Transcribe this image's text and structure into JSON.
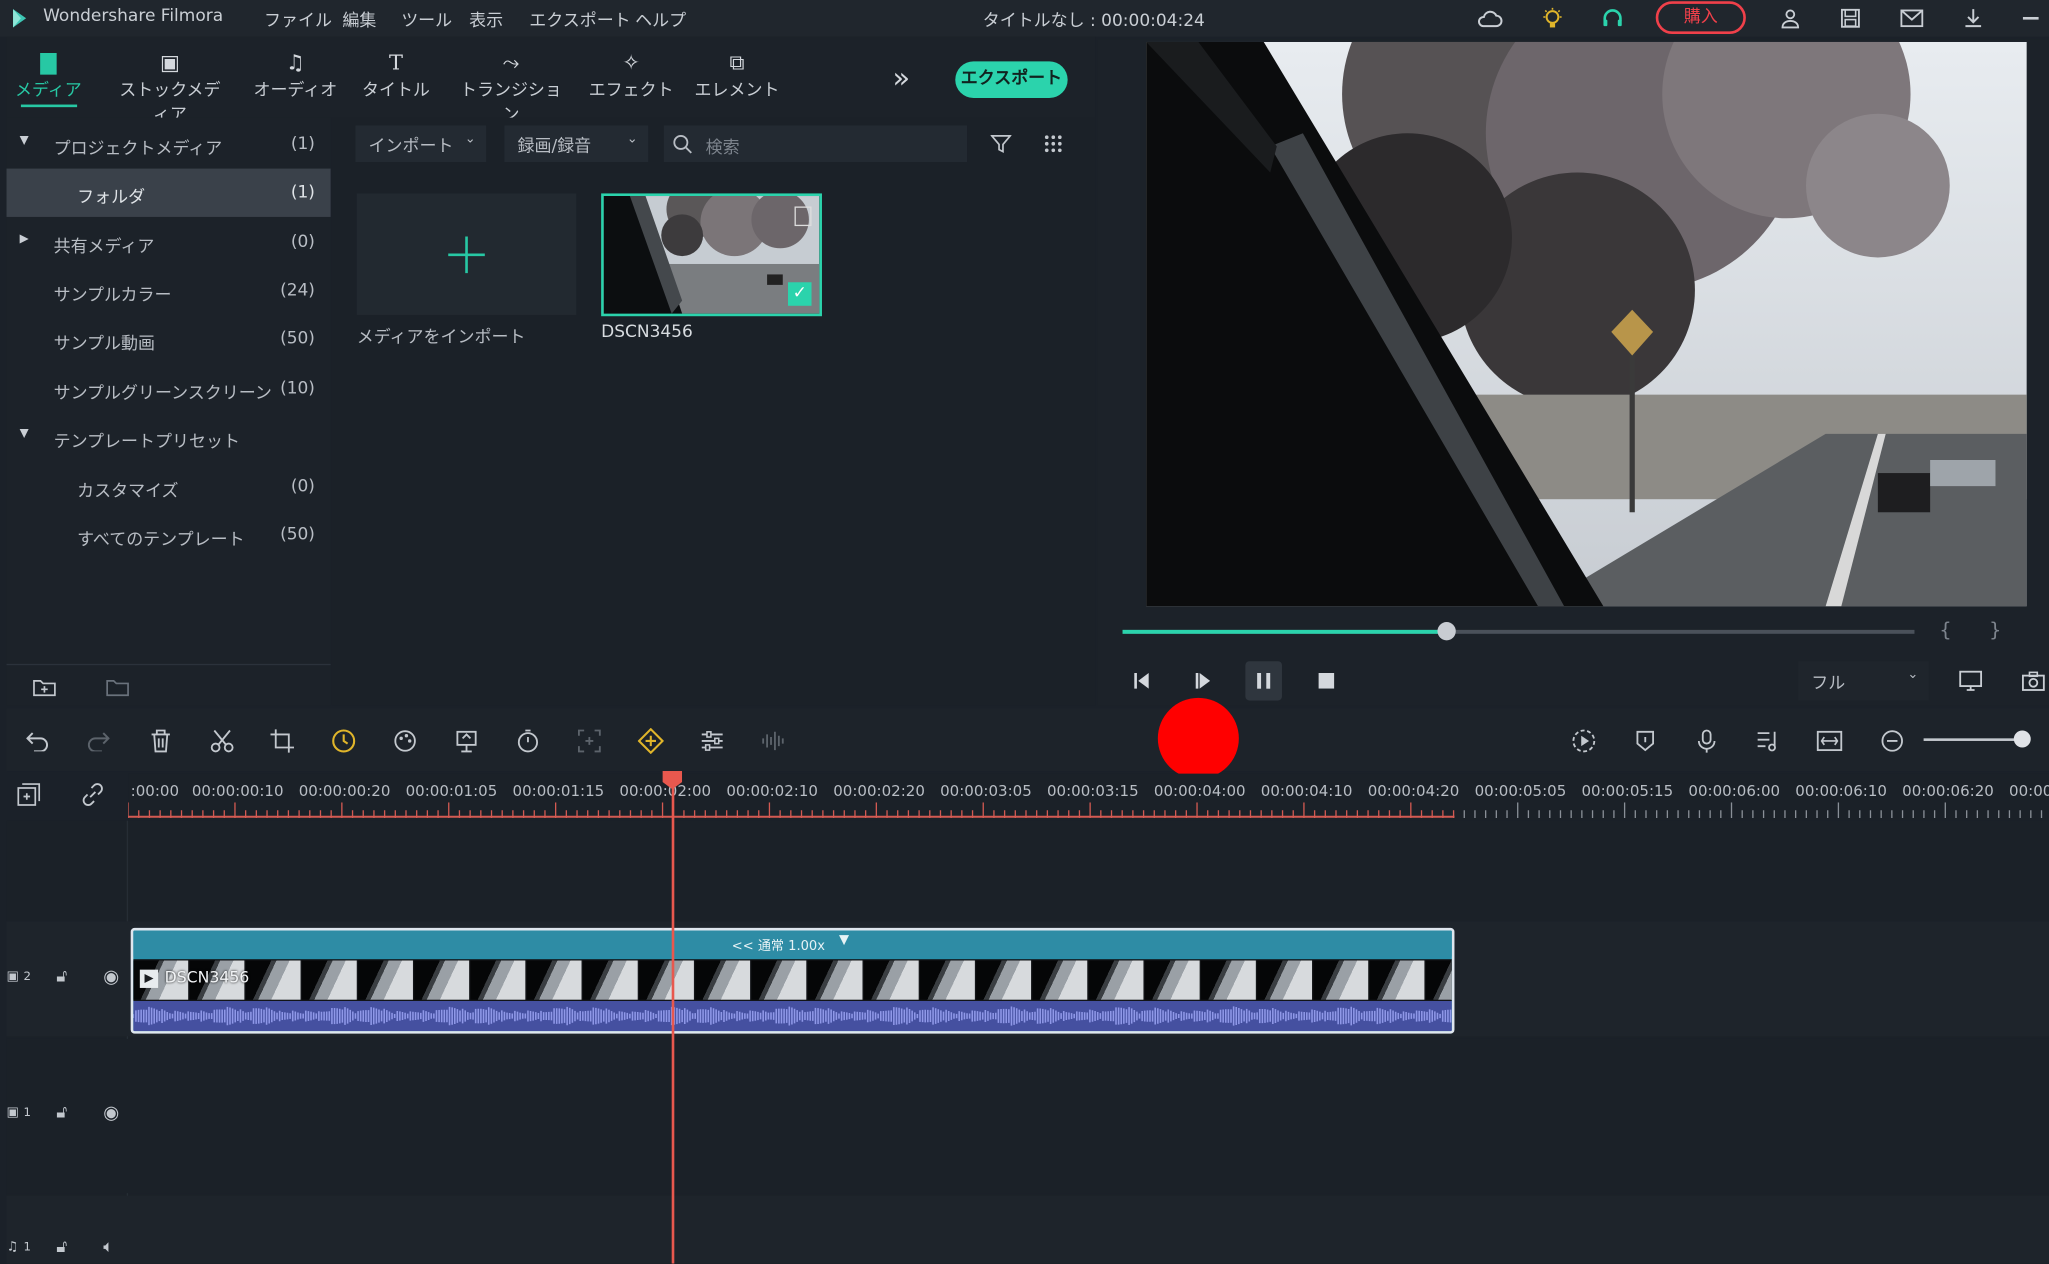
{
  "app": {
    "name": "Wondershare Filmora",
    "menu": [
      "ファイル",
      "編集",
      "ツール",
      "表示",
      "エクスポート",
      "ヘルプ"
    ],
    "project_title": "タイトルなし : 00:00:04:24",
    "buy_label": "購入"
  },
  "tabs": [
    {
      "label": "メディア",
      "icon": "folder-icon"
    },
    {
      "label": "ストックメディア",
      "icon": "stock-media-icon"
    },
    {
      "label": "オーディオ",
      "icon": "music-note-icon"
    },
    {
      "label": "タイトル",
      "icon": "title-text-icon"
    },
    {
      "label": "トランジション",
      "icon": "transition-icon"
    },
    {
      "label": "エフェクト",
      "icon": "effects-icon"
    },
    {
      "label": "エレメント",
      "icon": "elements-icon"
    }
  ],
  "export_label": "エクスポート",
  "library": [
    {
      "name": "プロジェクトメディア",
      "count": "(1)",
      "arrow": "▼"
    },
    {
      "name": "フォルダ",
      "count": "(1)",
      "arrow": ""
    },
    {
      "name": "共有メディア",
      "count": "(0)",
      "arrow": "▶"
    },
    {
      "name": "サンプルカラー",
      "count": "(24)",
      "arrow": ""
    },
    {
      "name": "サンプル動画",
      "count": "(50)",
      "arrow": ""
    },
    {
      "name": "サンプルグリーンスクリーン",
      "count": "(10)",
      "arrow": ""
    },
    {
      "name": "テンプレートプリセット",
      "count": "",
      "arrow": "▼"
    },
    {
      "name": "カスタマイズ",
      "count": "(0)",
      "arrow": ""
    },
    {
      "name": "すべてのテンプレート",
      "count": "(50)",
      "arrow": ""
    }
  ],
  "media_toolbar": {
    "import_label": "インポート",
    "record_label": "録画/録音",
    "search_placeholder": "検索"
  },
  "media_items": [
    {
      "label": "メディアをインポート"
    },
    {
      "label": "DSCN3456"
    }
  ],
  "preview": {
    "quality": "フル",
    "progress": 0.41
  },
  "timeline": {
    "timecodes": [
      ":00:00",
      "00:00:00:10",
      "00:00:00:20",
      "00:00:01:05",
      "00:00:01:15",
      "00:00:02:00",
      "00:00:02:10",
      "00:00:02:20",
      "00:00:03:05",
      "00:00:03:15",
      "00:00:04:00",
      "00:00:04:10",
      "00:00:04:20",
      "00:00:05:05",
      "00:00:05:15",
      "00:00:06:00",
      "00:00:06:10",
      "00:00:06:20",
      "00:00"
    ],
    "clip_name": "DSCN3456",
    "clip_speed": "<< 通常 1.00x",
    "tracks": [
      {
        "index": "2",
        "type": "video"
      },
      {
        "index": "1",
        "type": "video"
      },
      {
        "index": "1",
        "type": "audio"
      }
    ]
  }
}
